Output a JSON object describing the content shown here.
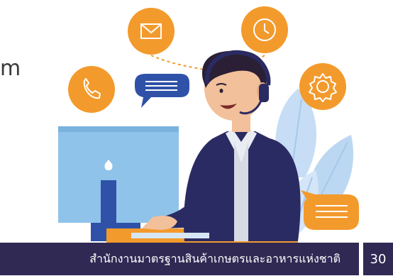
{
  "slide": {
    "partial_text": "m",
    "footer_text": "สำนักงานมาตรฐานสินค้าเกษตรและอาหารแห่งชาติ",
    "page_number": "30"
  },
  "icons": [
    "mail-icon",
    "clock-icon",
    "phone-icon",
    "chat-bubble-icon",
    "gear-icon",
    "message-bubble-icon"
  ],
  "colors": {
    "icon_orange": "#f39a2c",
    "bubble_blue": "#2f52a8",
    "footer_navy": "#2f2953",
    "suit_navy": "#2b2b63",
    "monitor_blue": "#8fc3ea",
    "leaf_blue": "#bcd7f2"
  }
}
